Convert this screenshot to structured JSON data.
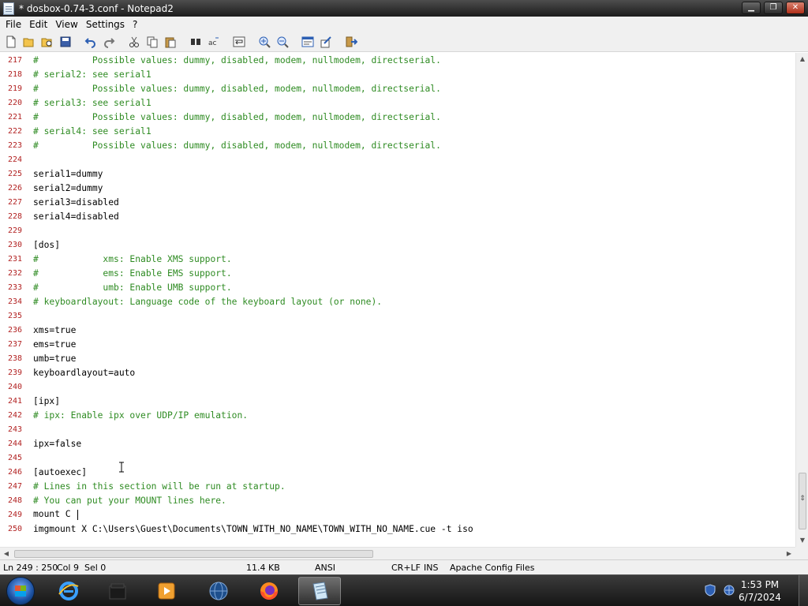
{
  "window": {
    "title": "* dosbox-0.74-3.conf - Notepad2",
    "minimize_glyph": "▁",
    "maximize_glyph": "❐",
    "close_glyph": "✕"
  },
  "menu": {
    "items": [
      "File",
      "Edit",
      "View",
      "Settings",
      "?"
    ]
  },
  "toolbar": {
    "buttons": [
      "new-icon",
      "open-icon",
      "browse-icon",
      "save-icon",
      "undo-icon",
      "redo-icon",
      "cut-icon",
      "copy-icon",
      "paste-icon",
      "find-icon",
      "replace-icon",
      "word-wrap-icon",
      "zoom-in-icon",
      "zoom-out-icon",
      "schemes-icon",
      "customize-icon",
      "exit-icon"
    ]
  },
  "editor": {
    "lines": [
      {
        "n": "217",
        "text": "#          Possible values: dummy, disabled, modem, nullmodem, directserial.",
        "comment": true
      },
      {
        "n": "218",
        "text": "# serial2: see serial1",
        "comment": true
      },
      {
        "n": "219",
        "text": "#          Possible values: dummy, disabled, modem, nullmodem, directserial.",
        "comment": true
      },
      {
        "n": "220",
        "text": "# serial3: see serial1",
        "comment": true
      },
      {
        "n": "221",
        "text": "#          Possible values: dummy, disabled, modem, nullmodem, directserial.",
        "comment": true
      },
      {
        "n": "222",
        "text": "# serial4: see serial1",
        "comment": true
      },
      {
        "n": "223",
        "text": "#          Possible values: dummy, disabled, modem, nullmodem, directserial.",
        "comment": true
      },
      {
        "n": "224",
        "text": "",
        "comment": false
      },
      {
        "n": "225",
        "text": "serial1=dummy",
        "comment": false
      },
      {
        "n": "226",
        "text": "serial2=dummy",
        "comment": false
      },
      {
        "n": "227",
        "text": "serial3=disabled",
        "comment": false
      },
      {
        "n": "228",
        "text": "serial4=disabled",
        "comment": false
      },
      {
        "n": "229",
        "text": "",
        "comment": false
      },
      {
        "n": "230",
        "text": "[dos]",
        "comment": false
      },
      {
        "n": "231",
        "text": "#            xms: Enable XMS support.",
        "comment": true
      },
      {
        "n": "232",
        "text": "#            ems: Enable EMS support.",
        "comment": true
      },
      {
        "n": "233",
        "text": "#            umb: Enable UMB support.",
        "comment": true
      },
      {
        "n": "234",
        "text": "# keyboardlayout: Language code of the keyboard layout (or none).",
        "comment": true
      },
      {
        "n": "235",
        "text": "",
        "comment": false
      },
      {
        "n": "236",
        "text": "xms=true",
        "comment": false
      },
      {
        "n": "237",
        "text": "ems=true",
        "comment": false
      },
      {
        "n": "238",
        "text": "umb=true",
        "comment": false
      },
      {
        "n": "239",
        "text": "keyboardlayout=auto",
        "comment": false
      },
      {
        "n": "240",
        "text": "",
        "comment": false
      },
      {
        "n": "241",
        "text": "[ipx]",
        "comment": false
      },
      {
        "n": "242",
        "text": "# ipx: Enable ipx over UDP/IP emulation.",
        "comment": true
      },
      {
        "n": "243",
        "text": "",
        "comment": false
      },
      {
        "n": "244",
        "text": "ipx=false",
        "comment": false
      },
      {
        "n": "245",
        "text": "",
        "comment": false
      },
      {
        "n": "246",
        "text": "[autoexec]",
        "comment": false
      },
      {
        "n": "247",
        "text": "# Lines in this section will be run at startup.",
        "comment": true
      },
      {
        "n": "248",
        "text": "# You can put your MOUNT lines here.",
        "comment": true
      },
      {
        "n": "249",
        "text": "mount C ",
        "comment": false,
        "caret": true
      },
      {
        "n": "250",
        "text": "imgmount X C:\\Users\\Guest\\Documents\\TOWN_WITH_NO_NAME\\TOWN_WITH_NO_NAME.cue -t iso",
        "comment": false
      }
    ]
  },
  "statusbar": {
    "position": "Ln 249 : 250",
    "col": "Col 9",
    "sel": "Sel 0",
    "size": "11.4 KB",
    "encoding": "ANSI",
    "line_endings": "CR+LF",
    "mode": "INS",
    "scheme": "Apache Config Files"
  },
  "taskbar": {
    "apps": [
      "internet-explorer-icon",
      "file-explorer-icon",
      "media-player-icon",
      "network-globe-icon",
      "firefox-icon",
      "notepad2-icon"
    ],
    "time": "1:53 PM",
    "date": "6/7/2024"
  },
  "colors": {
    "comment": "#2e8b22",
    "line_number": "#b22222",
    "text": "#000000"
  }
}
